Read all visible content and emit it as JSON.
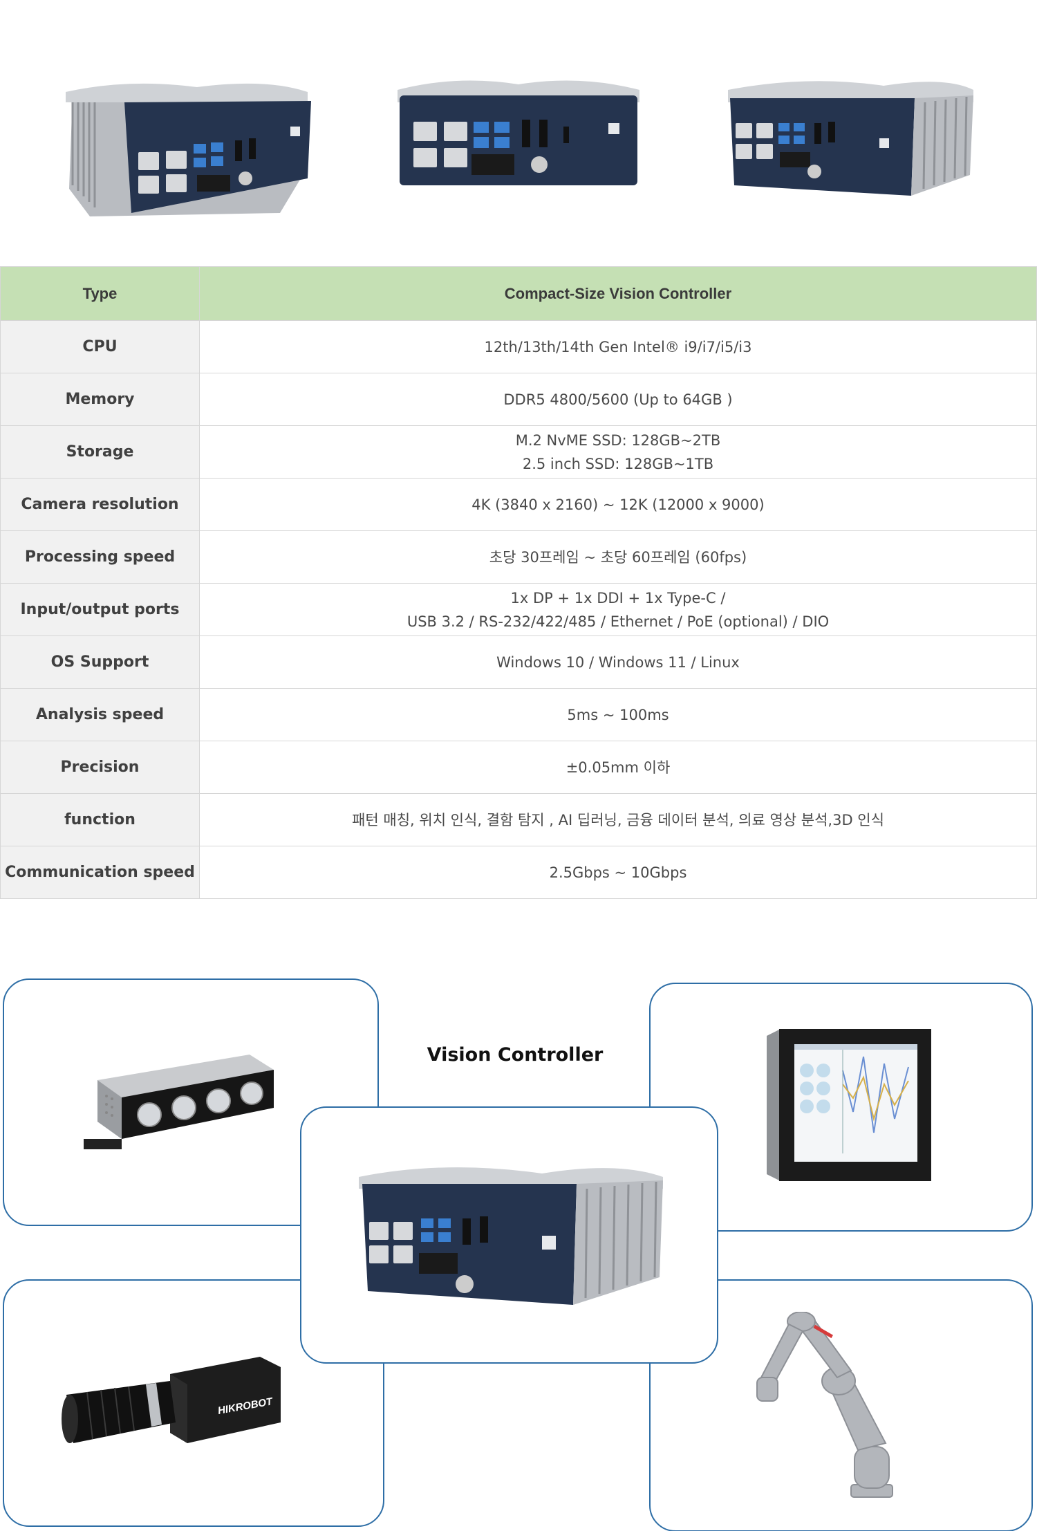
{
  "spec_table": {
    "header": {
      "label": "Type",
      "value": "Compact-Size Vision Controller"
    },
    "rows": [
      {
        "label": "CPU",
        "lines": [
          "12th/13th/14th Gen Intel® i9/i7/i5/i3"
        ]
      },
      {
        "label": "Memory",
        "lines": [
          "DDR5 4800/5600  (Up to 64GB )"
        ]
      },
      {
        "label": "Storage",
        "lines": [
          "M.2 NvME SSD: 128GB~2TB",
          "2.5 inch SSD: 128GB~1TB"
        ]
      },
      {
        "label": "Camera resolution",
        "lines": [
          "4K (3840 x 2160)  ~ 12K (12000 x 9000)"
        ]
      },
      {
        "label": "Processing speed",
        "lines": [
          "초당 30프레임 ~  초당 60프레임 (60fps)"
        ]
      },
      {
        "label": "Input/output ports",
        "lines": [
          "1x DP + 1x DDI + 1x Type-C /",
          "USB 3.2 / RS-232/422/485 /  Ethernet  / PoE (optional) / DIO"
        ]
      },
      {
        "label": "OS Support",
        "lines": [
          "Windows 10 / Windows 11 / Linux"
        ]
      },
      {
        "label": "Analysis speed",
        "lines": [
          "5ms ~ 100ms"
        ]
      },
      {
        "label": "Precision",
        "lines": [
          "±0.05mm 이하"
        ]
      },
      {
        "label": "function",
        "lines": [
          "패턴 매칭, 위치 인식, 결함 탐지 , AI 딥러닝, 금융 데이터 분석, 의료 영상 분석,3D 인식"
        ]
      },
      {
        "label": "Communication speed",
        "lines": [
          "2.5Gbps ~ 10Gbps"
        ]
      }
    ]
  },
  "diagram": {
    "title": "Vision Controller",
    "camera_brand": "HIKROBOT"
  },
  "colors": {
    "header_green": "#c5e0b4",
    "label_gray": "#f1f1f1",
    "box_border": "#2e6ea6",
    "chassis_navy": "#25344f",
    "usb_blue": "#3a7fd0"
  }
}
